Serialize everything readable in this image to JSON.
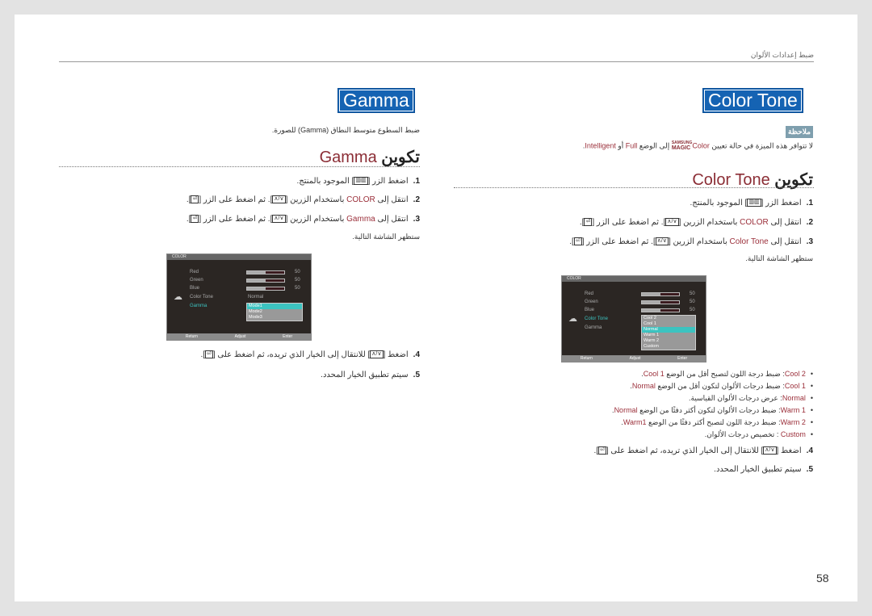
{
  "header": {
    "section": "ضبط إعدادات الألوان"
  },
  "page_number": "58",
  "left": {
    "title": "Gamma",
    "intro": "ضبط السطوع متوسط النطاق (Gamma) للصورة.",
    "heading_en": "Gamma",
    "heading_ar": "تكوين",
    "step1": {
      "num": "1.",
      "a": "اضغط الزر [",
      "b": "] الموجود بالمنتج."
    },
    "step2": {
      "num": "2.",
      "a": "انتقل إلى ",
      "hl": "COLOR",
      "b": " باستخدام الزرين [",
      "c": "]. ثم اضغط على الزر [",
      "d": "]."
    },
    "step3": {
      "num": "3.",
      "a": "انتقل إلى ",
      "hl": "Gamma",
      "b": " باستخدام الزرين [",
      "c": "]. ثم اضغط على الزر [",
      "d": "]."
    },
    "screen_text": "ستظهر الشاشة التالية.",
    "step4": {
      "num": "4.",
      "a": "اضغط [",
      "b": "] للانتقال إلى الخيار الذي تريده، ثم اضغط على [",
      "c": "]."
    },
    "step5": {
      "num": "5.",
      "a": "سيتم تطبيق الخيار المحدد."
    },
    "osd": {
      "title": "COLOR",
      "items": [
        "Red",
        "Green",
        "Blue",
        "Color Tone",
        "Gamma"
      ],
      "values": [
        "50",
        "50",
        "50"
      ],
      "bar_level": 0.5,
      "color_tone_value": "Normal",
      "options": [
        "Mode1",
        "Mode2",
        "Mode3"
      ],
      "selected": "Mode1",
      "footer": [
        "Return",
        "Adjust",
        "Enter"
      ]
    }
  },
  "right": {
    "title": "Color Tone",
    "note_label": "ملاحظة",
    "note": {
      "a": "لا تتوافر هذه الميزة في حالة تعيين ",
      "logo_top": "SAMSUNG",
      "logo_bottom": "MAGIC",
      "b": "Color",
      "c": " إلى الوضع ",
      "d": "Full",
      "e": " أو ",
      "f": "Intelligent",
      "g": "."
    },
    "heading_en": "Color Tone",
    "heading_ar": "تكوين",
    "step1": {
      "num": "1.",
      "a": "اضغط الزر [",
      "b": "] الموجود بالمنتج."
    },
    "step2": {
      "num": "2.",
      "a": "انتقل إلى ",
      "hl": "COLOR",
      "b": " باستخدام الزرين [",
      "c": "]. ثم اضغط على الزر [",
      "d": "]."
    },
    "step3": {
      "num": "3.",
      "a": "انتقل إلى ",
      "hl": "Color Tone",
      "b": " باستخدام الزرين [",
      "c": "]. ثم اضغط على الزر [",
      "d": "]."
    },
    "screen_text": "ستظهر الشاشة التالية.",
    "bullets": [
      {
        "name": "Cool 2",
        "desc": ": ضبط درجة اللون لتصبح أقل من الوضع ",
        "ref": "Cool 1",
        "end": "."
      },
      {
        "name": "Cool 1",
        "desc": ": ضبط درجات الألوان لتكون أقل من الوضع ",
        "ref": "Normal",
        "end": "."
      },
      {
        "name": "Normal",
        "desc": ": عرض درجات الألوان القياسية.",
        "ref": "",
        "end": ""
      },
      {
        "name": "Warm 1",
        "desc": ": ضبط درجات الألوان لتكون أكثر دفئًا من الوضع ",
        "ref": "Normal",
        "end": "."
      },
      {
        "name": "Warm 2",
        "desc": ": ضبط درجة اللون لتصبح أكثر دفئًا من الوضع ",
        "ref": "Warm1",
        "end": "."
      },
      {
        "name": "Custom",
        "desc": " : تخصيص درجات الألوان.",
        "ref": "",
        "end": ""
      }
    ],
    "step4": {
      "num": "4.",
      "a": "اضغط [",
      "b": "] للانتقال إلى الخيار الذي تريده، ثم اضغط على [",
      "c": "]."
    },
    "step5": {
      "num": "5.",
      "a": "سيتم تطبيق الخيار المحدد."
    },
    "osd": {
      "title": "COLOR",
      "items": [
        "Red",
        "Green",
        "Blue",
        "Color Tone",
        "Gamma"
      ],
      "values": [
        "50",
        "50",
        "50"
      ],
      "bar_level": 0.5,
      "options": [
        "Cool 2",
        "Cool 1",
        "Normal",
        "Warm 1",
        "Warm 2",
        "Custom"
      ],
      "selected": "Normal",
      "footer": [
        "Return",
        "Adjust",
        "Enter"
      ]
    }
  },
  "icons": {
    "menu": "menu-button-icon",
    "updown": "up-down-arrows-icon",
    "enter": "enter-source-icon"
  },
  "colors": {
    "title_box": "#1563b3",
    "highlight": "#9b2f3a",
    "note_badge": "#7f9fae",
    "osd_selected": "#3cc3c0"
  }
}
